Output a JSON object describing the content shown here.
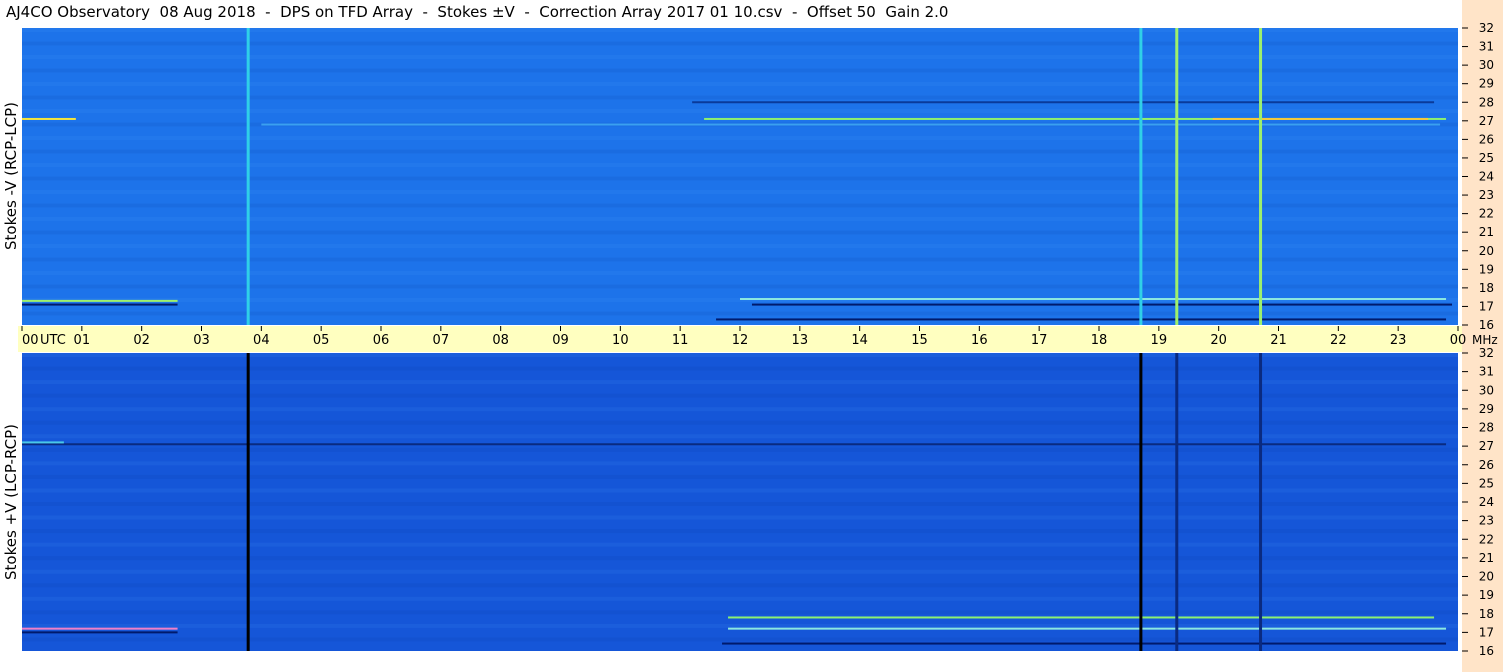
{
  "title": "AJ4CO Observatory  08 Aug 2018  -  DPS on TFD Array  -  Stokes ±V  -  Correction Array 2017 01 10.csv  -  Offset 50  Gain 2.0",
  "chart_data": [
    {
      "type": "heatmap",
      "name": "top-panel",
      "ylabel": "Stokes -V (RCP-LCP)",
      "y_unit": "MHz",
      "ylim": [
        16,
        32
      ],
      "y_ticks": [
        "16",
        "17",
        "18",
        "19",
        "20",
        "21",
        "22",
        "23",
        "24",
        "25",
        "26",
        "27",
        "28",
        "29",
        "30",
        "31",
        "32"
      ],
      "x_unit": "UTC",
      "xlim_hours": [
        0,
        24
      ],
      "x_ticks": [
        "00",
        "01",
        "02",
        "03",
        "04",
        "05",
        "06",
        "07",
        "08",
        "09",
        "10",
        "11",
        "12",
        "13",
        "14",
        "15",
        "16",
        "17",
        "18",
        "19",
        "20",
        "21",
        "22",
        "23",
        "00"
      ],
      "background_color": "#1d73ea",
      "vertical_lines": [
        {
          "time_h": 3.78,
          "color": "#2fd0e8"
        },
        {
          "time_h": 18.7,
          "color": "#2fd0e8"
        },
        {
          "time_h": 19.3,
          "color": "#9ef06c"
        },
        {
          "time_h": 20.7,
          "color": "#9ef06c"
        }
      ],
      "bands": [
        {
          "freq_mhz": 27.1,
          "t_start_h": 0.0,
          "t_end_h": 0.9,
          "color": "#f5e63c"
        },
        {
          "freq_mhz": 27.1,
          "t_start_h": 11.4,
          "t_end_h": 23.8,
          "color": "#8cf070"
        },
        {
          "freq_mhz": 27.1,
          "t_start_h": 19.9,
          "t_end_h": 23.5,
          "color": "#f5c83c"
        },
        {
          "freq_mhz": 17.3,
          "t_start_h": 0.0,
          "t_end_h": 2.6,
          "color": "#9ef06c"
        },
        {
          "freq_mhz": 17.1,
          "t_start_h": 0.0,
          "t_end_h": 2.6,
          "color": "#001a6c"
        },
        {
          "freq_mhz": 17.4,
          "t_start_h": 12.0,
          "t_end_h": 23.8,
          "color": "#8ce8e0"
        },
        {
          "freq_mhz": 17.1,
          "t_start_h": 12.2,
          "t_end_h": 23.9,
          "color": "#001a6c"
        },
        {
          "freq_mhz": 16.3,
          "t_start_h": 11.6,
          "t_end_h": 23.8,
          "color": "#001a6c"
        },
        {
          "freq_mhz": 28.0,
          "t_start_h": 11.2,
          "t_end_h": 23.6,
          "color": "#0a3a9a"
        },
        {
          "freq_mhz": 26.8,
          "t_start_h": 4.0,
          "t_end_h": 23.7,
          "color": "#3aa0f0"
        }
      ]
    },
    {
      "type": "heatmap",
      "name": "bottom-panel",
      "ylabel": "Stokes +V (LCP-RCP)",
      "y_unit": "MHz",
      "ylim": [
        16,
        32
      ],
      "y_ticks": [
        "16",
        "17",
        "18",
        "19",
        "20",
        "21",
        "22",
        "23",
        "24",
        "25",
        "26",
        "27",
        "28",
        "29",
        "30",
        "31",
        "32"
      ],
      "x_unit": "UTC",
      "xlim_hours": [
        0,
        24
      ],
      "background_color": "#1556d8",
      "vertical_lines": [
        {
          "time_h": 3.78,
          "color": "#000000"
        },
        {
          "time_h": 18.7,
          "color": "#000000"
        },
        {
          "time_h": 19.3,
          "color": "#0a2a80"
        },
        {
          "time_h": 20.7,
          "color": "#0a2a80"
        }
      ],
      "bands": [
        {
          "freq_mhz": 27.1,
          "t_start_h": 0.0,
          "t_end_h": 23.8,
          "color": "#0a2a80"
        },
        {
          "freq_mhz": 27.2,
          "t_start_h": 0.0,
          "t_end_h": 0.7,
          "color": "#49c8e8"
        },
        {
          "freq_mhz": 17.2,
          "t_start_h": 0.0,
          "t_end_h": 2.6,
          "color": "#f080c8"
        },
        {
          "freq_mhz": 17.0,
          "t_start_h": 0.0,
          "t_end_h": 2.6,
          "color": "#001a6c"
        },
        {
          "freq_mhz": 17.2,
          "t_start_h": 11.8,
          "t_end_h": 23.8,
          "color": "#8ce8e0"
        },
        {
          "freq_mhz": 17.8,
          "t_start_h": 11.8,
          "t_end_h": 23.6,
          "color": "#8cf070"
        },
        {
          "freq_mhz": 16.4,
          "t_start_h": 11.7,
          "t_end_h": 23.8,
          "color": "#001a6c"
        }
      ]
    }
  ],
  "colors": {
    "time_strip": "#ffffc0",
    "right_panel": "#ffe4c8"
  }
}
